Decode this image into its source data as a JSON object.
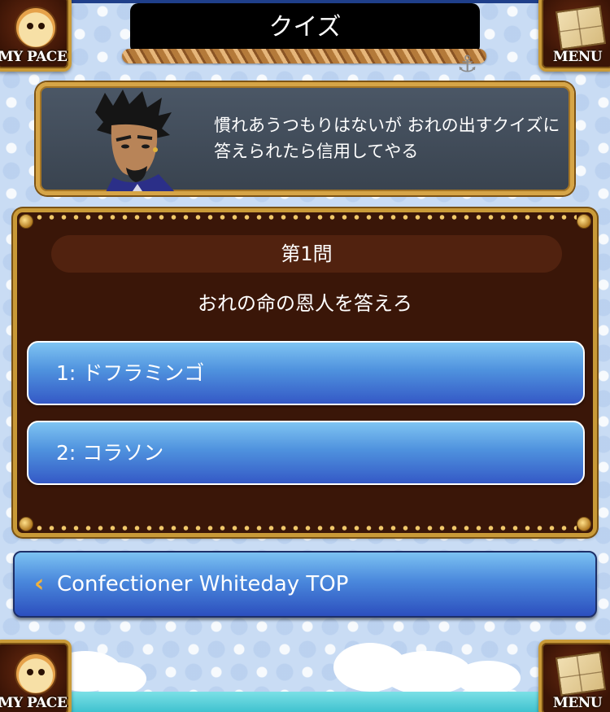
{
  "header": {
    "title": "クイズ",
    "mypage_label": "MY PACE",
    "menu_label": "MENU"
  },
  "dialog": {
    "text": "慣れあうつもりはないが おれの出すクイズに答えられたら信用してやる"
  },
  "quiz": {
    "number": "第1問",
    "question": "おれの命の恩人を答えろ",
    "answers": [
      "1: ドフラミンゴ",
      "2: コラソン"
    ]
  },
  "back_button": {
    "label": "Confectioner Whiteday TOP"
  },
  "footer": {
    "mypage_label": "MY PACE",
    "menu_label": "MENU"
  },
  "colors": {
    "button_top": "#7fc4f2",
    "button_bottom": "#3459c6",
    "panel": "#3a1608",
    "frame_gold": "#c99a38"
  }
}
